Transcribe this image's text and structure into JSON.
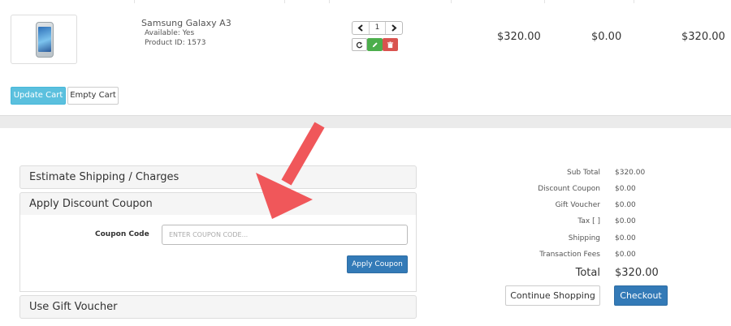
{
  "cart": {
    "item": {
      "name": "Samsung Galaxy A3",
      "available": "Available: Yes",
      "product_id": "Product ID: 1573",
      "quantity": "1",
      "unit_price": "$320.00",
      "discount": "$0.00",
      "total": "$320.00",
      "image_icon": "phone-image"
    },
    "update_label": "Update Cart",
    "empty_label": "Empty Cart"
  },
  "accordion": {
    "shipping_label": "Estimate Shipping / Charges",
    "coupon_label": "Apply Discount Coupon",
    "voucher_label": "Use Gift Voucher",
    "coupon_code_label": "Coupon Code",
    "coupon_placeholder": "ENTER COUPON CODE...",
    "apply_label": "Apply Coupon"
  },
  "totals": {
    "rows": [
      {
        "label": "Sub Total",
        "value": "$320.00"
      },
      {
        "label": "Discount Coupon",
        "value": "$0.00"
      },
      {
        "label": "Gift Voucher",
        "value": "$0.00"
      },
      {
        "label": "Tax [ ]",
        "value": "$0.00"
      },
      {
        "label": "Shipping",
        "value": "$0.00"
      },
      {
        "label": "Transaction Fees",
        "value": "$0.00"
      }
    ],
    "grand_label": "Total",
    "grand_value": "$320.00"
  },
  "actions": {
    "continue_label": "Continue Shopping",
    "checkout_label": "Checkout"
  },
  "colors": {
    "info": "#5bc0de",
    "primary": "#337ab7",
    "success": "#4cae4c",
    "danger": "#d9534f",
    "annotation_arrow": "#f0575a"
  }
}
